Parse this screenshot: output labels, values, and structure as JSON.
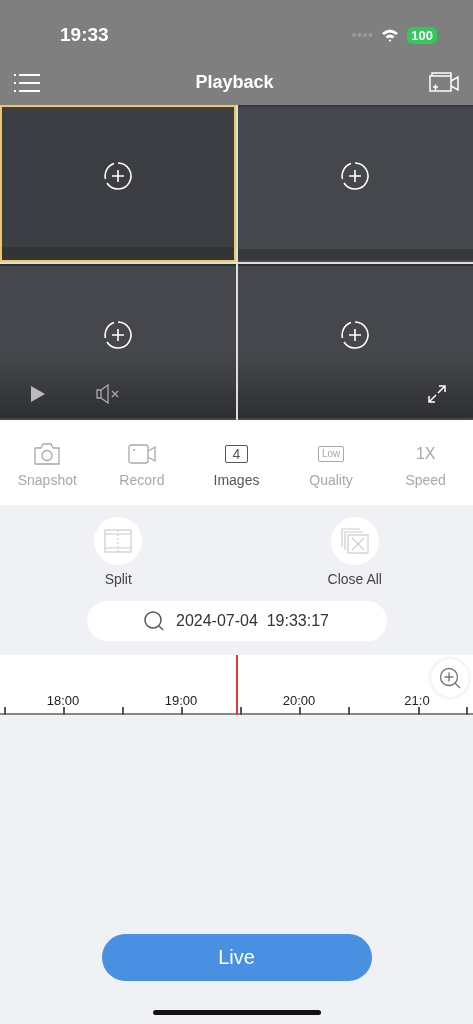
{
  "status_bar": {
    "time": "19:33",
    "battery": "100"
  },
  "nav": {
    "title": "Playback"
  },
  "video_cells": [
    {
      "selected": true
    },
    {
      "selected": false
    },
    {
      "selected": false
    },
    {
      "selected": false
    }
  ],
  "toolbar": [
    {
      "kind": "camera",
      "label": "Snapshot",
      "disabled": true
    },
    {
      "kind": "video",
      "label": "Record",
      "disabled": true
    },
    {
      "kind": "box",
      "icon_text": "4",
      "label": "Images",
      "disabled": false
    },
    {
      "kind": "small-box",
      "icon_text": "Low",
      "label": "Quality",
      "disabled": true
    },
    {
      "kind": "text",
      "icon_text": "1X",
      "label": "Speed",
      "disabled": true
    }
  ],
  "actions": [
    {
      "kind": "split",
      "label": "Split"
    },
    {
      "kind": "close-all",
      "label": "Close All"
    }
  ],
  "date_field": {
    "value": "2024-07-04  19:33:17"
  },
  "timeline": {
    "labels": [
      "18:00",
      "19:00",
      "20:00",
      "21:0"
    ]
  },
  "live_button": "Live"
}
